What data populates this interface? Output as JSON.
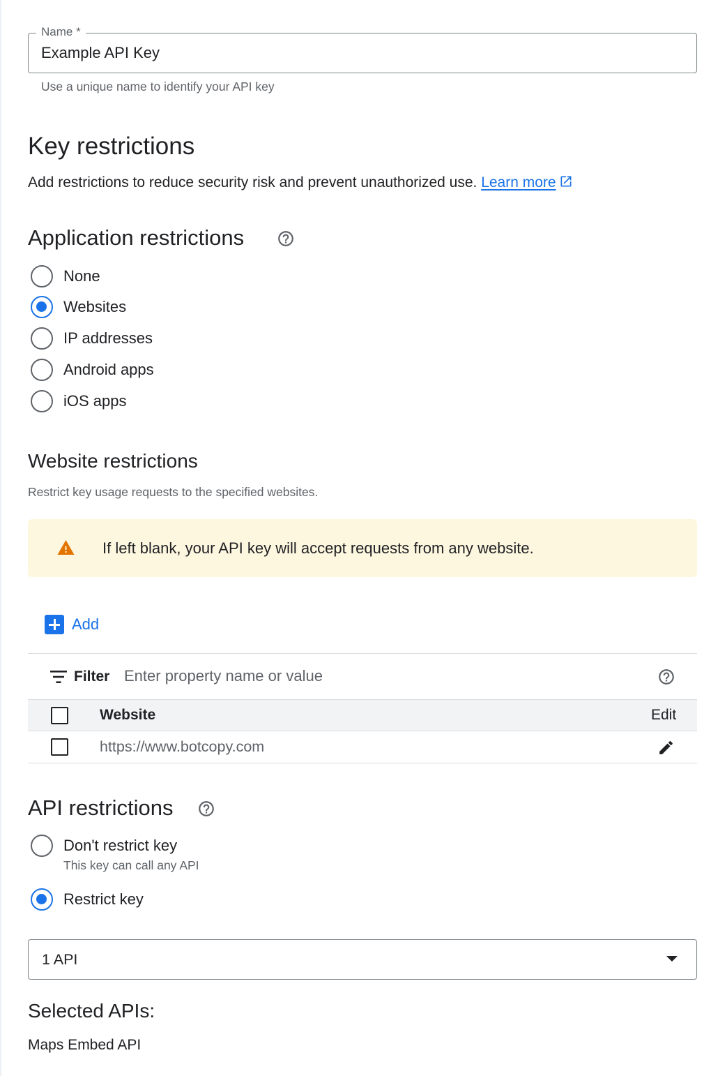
{
  "name_field": {
    "label": "Name *",
    "value": "Example API Key",
    "hint": "Use a unique name to identify your API key"
  },
  "key_restrictions": {
    "title": "Key restrictions",
    "description": "Add restrictions to reduce security risk and prevent unauthorized use.",
    "learn_more": "Learn more"
  },
  "application_restrictions": {
    "title": "Application restrictions",
    "options": [
      {
        "label": "None",
        "checked": false
      },
      {
        "label": "Websites",
        "checked": true
      },
      {
        "label": "IP addresses",
        "checked": false
      },
      {
        "label": "Android apps",
        "checked": false
      },
      {
        "label": "iOS apps",
        "checked": false
      }
    ]
  },
  "website_restrictions": {
    "title": "Website restrictions",
    "description": "Restrict key usage requests to the specified websites.",
    "warning": "If left blank, your API key will accept requests from any website.",
    "add_label": "Add",
    "filter": {
      "label": "Filter",
      "placeholder": "Enter property name or value"
    },
    "table": {
      "columns": [
        "Website",
        "Edit"
      ],
      "rows": [
        {
          "website": "https://www.botcopy.com"
        }
      ]
    }
  },
  "api_restrictions": {
    "title": "API restrictions",
    "options": [
      {
        "label": "Don't restrict key",
        "sublabel": "This key can call any API",
        "checked": false
      },
      {
        "label": "Restrict key",
        "checked": true
      }
    ],
    "select_value": "1 API",
    "selected_title": "Selected APIs:",
    "selected_apis": [
      "Maps Embed API"
    ]
  },
  "colors": {
    "accent": "#1a73e8",
    "warning_bg": "#fef7e0",
    "warning_icon": "#e37400"
  }
}
